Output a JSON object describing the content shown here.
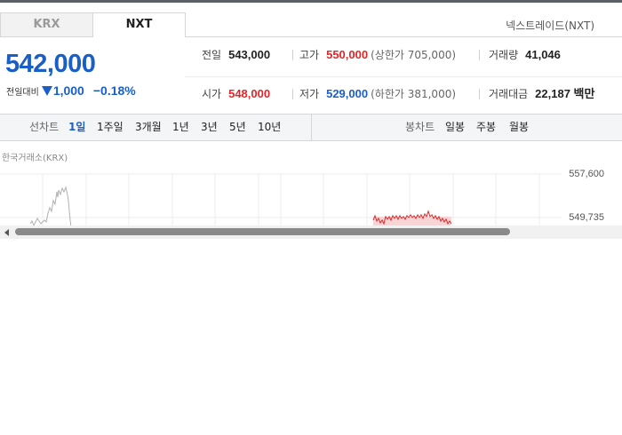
{
  "tabs": [
    {
      "label": "KRX",
      "active": false
    },
    {
      "label": "NXT",
      "active": true
    }
  ],
  "exchange_name": "넥스트레이드(NXT)",
  "quote": {
    "price": "542,000",
    "change_label": "전일대비",
    "change_direction": "down",
    "change_amount": "1,000",
    "change_rate": "−0.18%",
    "color_down": "#1a5fc8",
    "color_up": "#e0262a"
  },
  "stats": {
    "prev_close": {
      "label": "전일",
      "value": "543,000"
    },
    "high": {
      "label": "고가",
      "value": "550,000",
      "limit_text": "(상한가 705,000)"
    },
    "volume": {
      "label": "거래량",
      "value": "41,046"
    },
    "open": {
      "label": "시가",
      "value": "548,000"
    },
    "low": {
      "label": "저가",
      "value": "529,000",
      "limit_text": "(하한가 381,000)"
    },
    "trade_value": {
      "label": "거래대금",
      "value": "22,187 백만"
    }
  },
  "period_bar": {
    "line_title": "선차트",
    "line_periods": [
      "1일",
      "1주일",
      "3개월",
      "1년",
      "3년",
      "5년",
      "10년"
    ],
    "line_active": "1일",
    "candle_title": "봉차트",
    "candle_periods": [
      "일봉",
      "주봉",
      "월봉"
    ]
  },
  "chart": {
    "source_label": "한국거래소(KRX)",
    "y_ticks": [
      "557,600",
      "549,735"
    ],
    "krx_line_color": "#b0b0b0",
    "nxt_line_color": "#e0262a"
  },
  "scrollbar": {
    "thumb_fraction": 0.8
  }
}
